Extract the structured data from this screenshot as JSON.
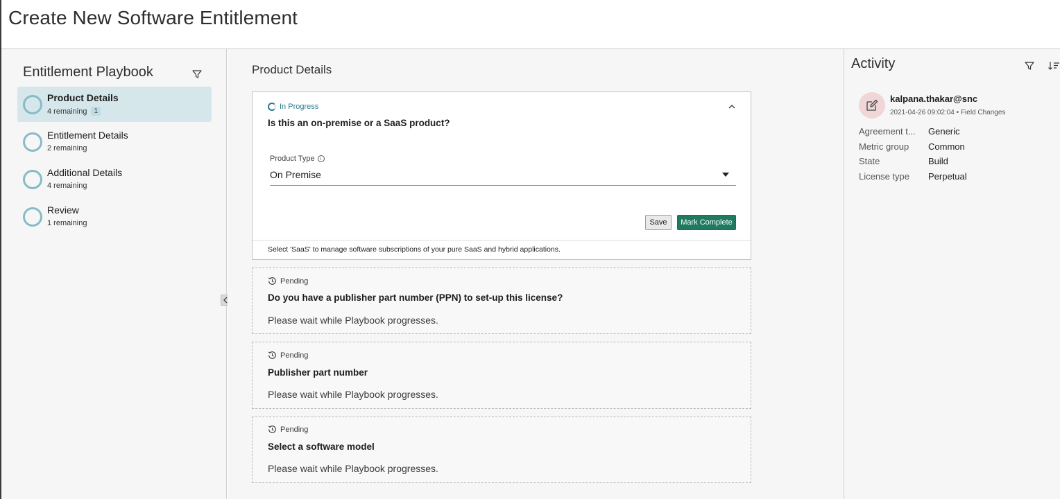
{
  "header": {
    "title": "Create New Software Entitlement"
  },
  "sidebar": {
    "title": "Entitlement Playbook",
    "items": [
      {
        "label": "Product Details",
        "sub": "4 remaining",
        "badge": "1"
      },
      {
        "label": "Entitlement Details",
        "sub": "2 remaining"
      },
      {
        "label": "Additional Details",
        "sub": "4 remaining"
      },
      {
        "label": "Review",
        "sub": "1 remaining"
      }
    ]
  },
  "main": {
    "title": "Product Details",
    "active_card": {
      "status": "In Progress",
      "question": "Is this an on-premise or a SaaS product?",
      "field_label": "Product Type",
      "field_value": "On Premise",
      "save_label": "Save",
      "complete_label": "Mark Complete",
      "footer": "Select 'SaaS' to manage software subscriptions of your pure SaaS and hybrid applications."
    },
    "pending_cards": [
      {
        "status": "Pending",
        "question": "Do you have a publisher part number (PPN) to set-up this license?",
        "message": "Please wait while Playbook progresses."
      },
      {
        "status": "Pending",
        "question": "Publisher part number",
        "message": "Please wait while Playbook progresses."
      },
      {
        "status": "Pending",
        "question": "Select a software model",
        "message": "Please wait while Playbook progresses."
      }
    ]
  },
  "activity": {
    "title": "Activity",
    "entry": {
      "user": "kalpana.thakar@snc",
      "timestamp": "2021-04-26 09:02:04",
      "separator": "•",
      "type": "Field Changes",
      "fields": [
        {
          "key": "Agreement t...",
          "value": "Generic"
        },
        {
          "key": "Metric group",
          "value": "Common"
        },
        {
          "key": "State",
          "value": "Build"
        },
        {
          "key": "License type",
          "value": "Perpetual"
        }
      ]
    }
  },
  "colors": {
    "accent": "#2a7a8c",
    "primary_button": "#1f7a5f",
    "active_item_bg": "#d6e7ec"
  }
}
